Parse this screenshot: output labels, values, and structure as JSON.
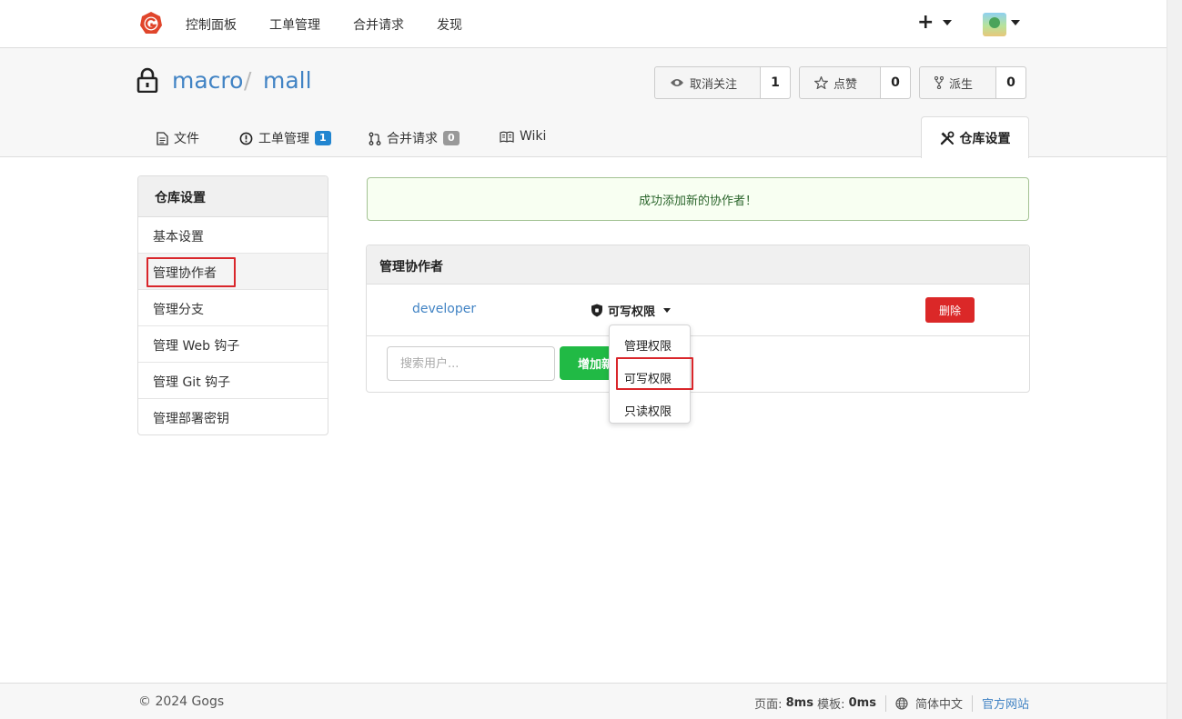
{
  "topnav": {
    "items": [
      "控制面板",
      "工单管理",
      "合并请求",
      "发现"
    ],
    "plus": "+",
    "icons": {
      "logo": "gogs-logo-icon",
      "avatar": "user-avatar"
    }
  },
  "repo": {
    "owner": "macro",
    "separator": "/",
    "name": "mall"
  },
  "actions": {
    "watch": {
      "label": "取消关注",
      "count": "1",
      "icon": "eye-icon"
    },
    "star": {
      "label": "点赞",
      "count": "0",
      "icon": "star-icon"
    },
    "fork": {
      "label": "派生",
      "count": "0",
      "icon": "fork-icon"
    }
  },
  "tabs": {
    "files": {
      "label": "文件"
    },
    "issues": {
      "label": "工单管理",
      "badge": "1"
    },
    "pulls": {
      "label": "合并请求",
      "badge": "0"
    },
    "wiki": {
      "label": "Wiki"
    },
    "settings": {
      "label": "仓库设置"
    }
  },
  "sidebar": {
    "title": "仓库设置",
    "items": [
      {
        "label": "基本设置"
      },
      {
        "label": "管理协作者"
      },
      {
        "label": "管理分支"
      },
      {
        "label": "管理 Web 钩子"
      },
      {
        "label": "管理 Git 钩子"
      },
      {
        "label": "管理部署密钥"
      }
    ],
    "active_index": 1
  },
  "message": {
    "text": "成功添加新的协作者！"
  },
  "collaborators": {
    "title": "管理协作者",
    "rows": [
      {
        "name": "developer",
        "permission": "可写权限",
        "delete_label": "删除"
      }
    ],
    "search_placeholder": "搜索用户...",
    "add_label": "增加新"
  },
  "permission_dropdown": {
    "options": [
      "管理权限",
      "可写权限",
      "只读权限"
    ],
    "selected": "可写权限"
  },
  "footer": {
    "copyright": "© 2024 Gogs",
    "page_label": "页面:",
    "page_time": "8ms",
    "template_label": "模板:",
    "template_time": "0ms",
    "language": "简体中文",
    "official_site": "官方网站"
  },
  "colors": {
    "link": "#4183c4",
    "success_bg": "#f8fff2",
    "success_text": "#2c662d",
    "danger": "#db2828",
    "primary_green": "#21ba45",
    "badge_blue": "#2185d0",
    "highlight_box": "#d9262b"
  }
}
